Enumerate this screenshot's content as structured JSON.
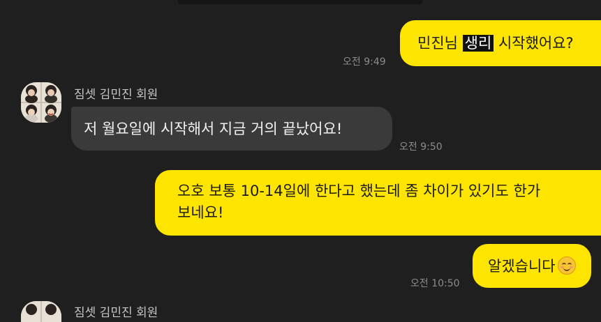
{
  "messages": [
    {
      "id": "m1",
      "from": "me",
      "parts": [
        "민진님 ",
        "생리",
        " 시작했어요?"
      ],
      "time": "오전 9:49"
    },
    {
      "id": "m2",
      "from": "them",
      "text": "저 월요일에 시작해서 지금 거의 끝났어요!",
      "time": "오전 9:50"
    },
    {
      "id": "m3",
      "from": "me",
      "line1": "오호 보통 10-14일에 한다고 했는데 좀 차이가 있기도 한가",
      "line2": "보네요!"
    },
    {
      "id": "m4",
      "from": "me",
      "text": "알겠습니다",
      "emoji": "smiling-face-emoji",
      "time": "오전 10:50"
    }
  ],
  "sender": {
    "name": "짐셋 김민진 회원",
    "avatar": "profile-photo-collage"
  },
  "next_sender": {
    "name": "짐셋 김민진 회원"
  },
  "colors": {
    "background": "#1f1f1f",
    "my_bubble": "#fee500",
    "their_bubble": "#3a3a3a",
    "timestamp": "#8c8c8c"
  }
}
